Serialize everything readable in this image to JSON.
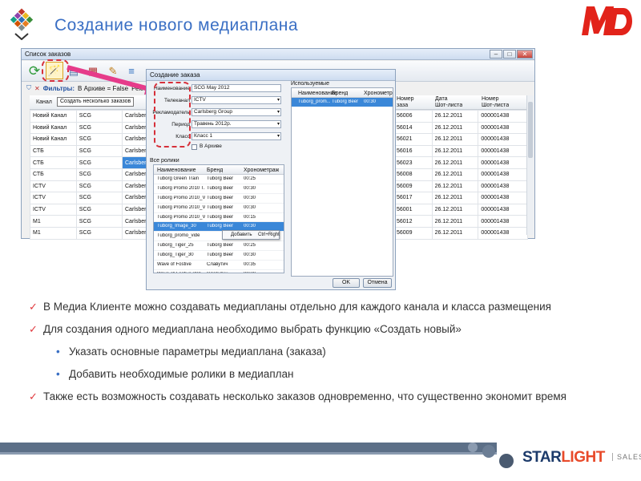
{
  "slide": {
    "title": "Создание нового медиаплана",
    "md_logo": "MD",
    "brand": {
      "star": "STAR",
      "light": "LIGHT",
      "sales": "SALES"
    },
    "accent_color": "#3a6fc4",
    "check_color": "#e0393e"
  },
  "orders_window": {
    "title": "Список заказов",
    "filter_label": "Фильтры:",
    "filter_value": "В Архиве = False",
    "filter_more": "Реклам",
    "tooltip": "Создать несколько заказов",
    "col_channel": "Канал",
    "rows": [
      {
        "channel": "Новий Канал",
        "seller": "SCG",
        "adv": "Carlsber"
      },
      {
        "channel": "Новий Канал",
        "seller": "SCG",
        "adv": "Carlsber"
      },
      {
        "channel": "Новий Канал",
        "seller": "SCG",
        "adv": "Carlsber"
      },
      {
        "channel": "СТБ",
        "seller": "SCG",
        "adv": "Carlsber"
      },
      {
        "channel": "СТБ",
        "seller": "SCG",
        "adv": "Carlsber"
      },
      {
        "channel": "СТБ",
        "seller": "SCG",
        "adv": "Carlsber"
      },
      {
        "channel": "ICTV",
        "seller": "SCG",
        "adv": "Carlsber"
      },
      {
        "channel": "ICTV",
        "seller": "SCG",
        "adv": "Carlsber"
      },
      {
        "channel": "ICTV",
        "seller": "SCG",
        "adv": "Carlsber"
      },
      {
        "channel": "M1",
        "seller": "SCG",
        "adv": "Carlsber"
      },
      {
        "channel": "M1",
        "seller": "SCG",
        "adv": "Carlsber"
      }
    ],
    "right_headers": {
      "num": "Номер\nзаза",
      "date": "Дата\nШот-листа",
      "sheet": "Номер\nШот-листа"
    },
    "right_rows": [
      {
        "num": "56006",
        "date": "26.12.2011",
        "sheet": "000001438"
      },
      {
        "num": "56014",
        "date": "26.12.2011",
        "sheet": "000001438"
      },
      {
        "num": "56021",
        "date": "26.12.2011",
        "sheet": "000001438"
      },
      {
        "num": "56016",
        "date": "26.12.2011",
        "sheet": "000001438"
      },
      {
        "num": "56023",
        "date": "26.12.2011",
        "sheet": "000001438"
      },
      {
        "num": "56008",
        "date": "26.12.2011",
        "sheet": "000001438"
      },
      {
        "num": "56009",
        "date": "26.12.2011",
        "sheet": "000001438"
      },
      {
        "num": "56017",
        "date": "26.12.2011",
        "sheet": "000001438"
      },
      {
        "num": "56001",
        "date": "26.12.2011",
        "sheet": "000001438"
      },
      {
        "num": "56012",
        "date": "26.12.2011",
        "sheet": "000001438"
      },
      {
        "num": "56009",
        "date": "26.12.2011",
        "sheet": "000001438"
      }
    ]
  },
  "dialog": {
    "title": "Создание заказа",
    "name_label": "Наименование",
    "name_value": "SCG May 2012",
    "channel_label": "Телеканал",
    "channel_value": "ICTV",
    "advertiser_label": "Рекламодатель",
    "advertiser_value": "Carlsberg Group",
    "period_label": "Период",
    "period_value": "Травень 2012р.",
    "class_label": "Класс",
    "class_value": "Класс 1",
    "archive_label": "В Архиве",
    "all_spots_label": "Все ролики",
    "used_label": "Используемые",
    "col_name": "Наименование",
    "col_brand": "Бренд",
    "col_timing": "Хронометраж",
    "spots": [
      {
        "name": "Tuborg Green Train",
        "brand": "Tuborg Beer",
        "timing": "00:25"
      },
      {
        "name": "Tuborg Promo 2010 T...",
        "brand": "Tuborg Beer",
        "timing": "00:30"
      },
      {
        "name": "Tuborg Promo 2010_V2",
        "brand": "Tuborg Beer",
        "timing": "00:30"
      },
      {
        "name": "Tuborg Promo 2010_V3",
        "brand": "Tuborg Beer",
        "timing": "00:30"
      },
      {
        "name": "Tuborg Promo 2010_V3",
        "brand": "Tuborg Beer",
        "timing": "00:15"
      },
      {
        "name": "Tuborg_Image_30",
        "brand": "Tuborg Beer",
        "timing": "00:30"
      },
      {
        "name": "Tuborg_promo_vide",
        "brand": "",
        "timing": ""
      },
      {
        "name": "Tuborg_Tiger_25",
        "brand": "Tuborg Beer",
        "timing": "00:25"
      },
      {
        "name": "Tuborg_Tiger_30",
        "brand": "Tuborg Beer",
        "timing": "00:30"
      },
      {
        "name": "Wave of Fostive",
        "brand": "Славутич",
        "timing": "00:35"
      },
      {
        "name": "Wave of Fostive 30(L...",
        "brand": "Славутич",
        "timing": "00:30"
      }
    ],
    "used": [
      {
        "name": "Tuborg_prom...",
        "brand": "Tuborg Beer",
        "timing": "00:30"
      }
    ],
    "context_add": "Добавить",
    "context_shortcut": "Ctrl+Right",
    "ok_label": "OK",
    "cancel_label": "Отмена"
  },
  "bullets": {
    "b1": "В Медиа Клиенте можно создавать медиапланы отдельно для каждого канала и класса размещения",
    "b2": "Для создания одного медиаплана необходимо выбрать функцию «Создать новый»",
    "s1": "Указать основные параметры медиаплана (заказа)",
    "s2": "Добавить необходимые ролики в медиаплан",
    "b3": "Также есть возможность создавать несколько заказов одновременно, что существенно экономит время"
  }
}
